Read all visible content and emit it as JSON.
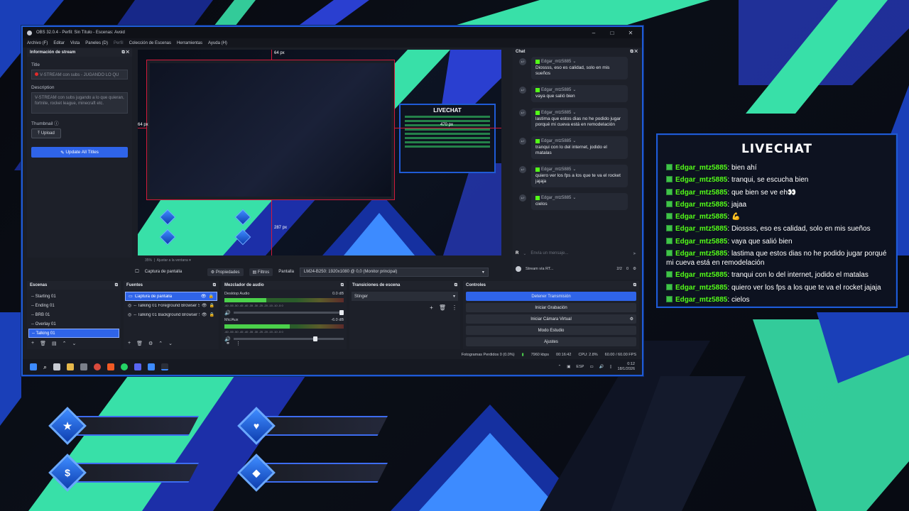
{
  "obs": {
    "window_title": "OBS 32.0.4 - Perfil: Sin Título - Escenas: Avoid",
    "menu": [
      "Archivo (F)",
      "Editar",
      "Vista",
      "Paneles (D)",
      "Perfil",
      "Colección de Escenas",
      "Herramientas",
      "Ayuda (H)"
    ],
    "window_controls": [
      "–",
      "□",
      "✕"
    ]
  },
  "stream_info": {
    "panel_title": "Información de stream",
    "title_label": "Title",
    "title_value": "V-STREAM con subs - JUGANDO LO QU",
    "description_label": "Description",
    "description_value": "V-STREAM con subs jugando a lo que quieran, fortnite, rocket league, minecraft etc.",
    "thumbnail_label": "Thumbnail",
    "upload_label": "Upload",
    "update_label": "Update All Titles"
  },
  "preview": {
    "guide_top": "64 px",
    "guide_left": "64 px",
    "guide_mid": "470 px",
    "guide_bottom": "287 px",
    "zoom": "35%",
    "fit": "Ajustar a la ventana",
    "mini_livechat_title": "LIVECHAT"
  },
  "source_bar": {
    "source_name": "Captura de pantalla",
    "properties": "Propiedades",
    "filters": "Filtros",
    "screen_label": "Pantalla",
    "screen_value": "LM24-B250: 1920x1080 @ 0,0 (Monitor principal)"
  },
  "chat": {
    "panel_title": "Chat",
    "messages": [
      {
        "user": "Edgar_mtz5885",
        "text": "Diossss, eso es calidad, solo en mis sueños"
      },
      {
        "user": "Edgar_mtz5885",
        "text": "vaya que salió bien"
      },
      {
        "user": "Edgar_mtz5885",
        "text": "lastima que estos dias no he podido jugar porqué mi cueva está en remodelación"
      },
      {
        "user": "Edgar_mtz5885",
        "text": "tranqui con lo del internet, jodido el matalas"
      },
      {
        "user": "Edgar_mtz5885",
        "text": "quiero ver los fps a los que te va el rocket jajaja"
      },
      {
        "user": "Edgar_mtz5885",
        "text": "cielos"
      }
    ],
    "input_placeholder": "Envía un mensaje...",
    "stream_via": "Stream vía RT...",
    "viewers": "2/2",
    "count": "0"
  },
  "docks": {
    "scenes": {
      "title": "Escenas",
      "items": [
        "-- Starting 01",
        "-- Ending 01",
        "-- BRB 01",
        "-- Overlay 01",
        "-- Talking 01"
      ],
      "selected": 4
    },
    "sources": {
      "title": "Fuentes",
      "items": [
        "Captura de pantalla",
        "-- Talking 01  Foreground Browser S",
        "-- Talking 01  Background Browser S"
      ]
    },
    "mixer": {
      "title": "Mezclador de audio",
      "channels": [
        {
          "name": "Desktop Audio",
          "db": "0.0 dB",
          "level": 0.35
        },
        {
          "name": "Mic/Aux",
          "db": "-6.0 dB",
          "level": 0.55
        }
      ],
      "scale": "-60 -55 -50 -45 -40 -35 -30 -25 -20 -15 -10 -5 0"
    },
    "transitions": {
      "title": "Transiciones de escena",
      "value": "Stinger"
    },
    "controls": {
      "title": "Controles",
      "buttons": [
        "Detener Transmisión",
        "Iniciar Grabación",
        "Iniciar Cámara Virtual",
        "Modo Estudio",
        "Ajustes"
      ]
    }
  },
  "status": {
    "dropped": "Fotogramas Perdidos 0 (0.0%)",
    "kbps": "7960 kbps",
    "time": "00:16:42",
    "cpu": "CPU: 2.8%",
    "fps": "60.00 / 60.00 FPS"
  },
  "taskbar": {
    "lang": "ESP",
    "time": "0:12",
    "date": "18/1/2026"
  },
  "livechat": {
    "title": "LIVECHAT",
    "messages": [
      {
        "user": "Edgar_mtz5885",
        "text": "bien ahí"
      },
      {
        "user": "Edgar_mtz5885",
        "text": "tranqui, se escucha bien"
      },
      {
        "user": "Edgar_mtz5885",
        "text": "que bien se ve eh👀"
      },
      {
        "user": "Edgar_mtz5885",
        "text": "jajaa"
      },
      {
        "user": "Edgar_mtz5885",
        "text": "💪"
      },
      {
        "user": "Edgar_mtz5885",
        "text": "Diossss, eso es calidad, solo en mis sueños"
      },
      {
        "user": "Edgar_mtz5885",
        "text": "vaya que salió bien"
      },
      {
        "user": "Edgar_mtz5885",
        "text": "lastima que estos dias no he podido jugar porqué mi cueva está en remodelación"
      },
      {
        "user": "Edgar_mtz5885",
        "text": "tranqui con lo del internet, jodido el matalas"
      },
      {
        "user": "Edgar_mtz5885",
        "text": "quiero ver los fps a los que te va el rocket jajaja"
      },
      {
        "user": "Edgar_mtz5885",
        "text": "cielos"
      }
    ]
  },
  "overlay_icons": [
    "★",
    "♥",
    "$",
    "◆"
  ],
  "colors": {
    "accent": "#2f64e8",
    "kick_green": "#53fc18",
    "teal": "#38e0a8",
    "border_blue": "#1f5bd6"
  }
}
